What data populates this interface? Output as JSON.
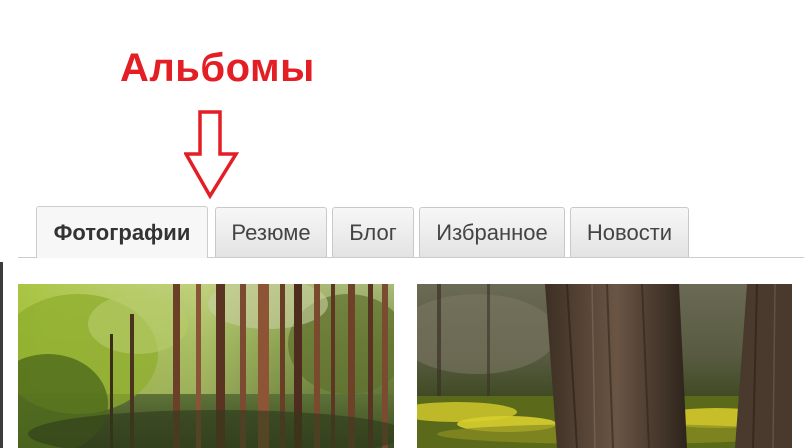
{
  "annotation": {
    "label": "Альбомы",
    "color": "#e31e24",
    "arrow_icon": "down-arrow-icon"
  },
  "tabs": [
    {
      "label": "Фотографии",
      "active": true
    },
    {
      "label": "Резюме",
      "active": false
    },
    {
      "label": "Блог",
      "active": false
    },
    {
      "label": "Избранное",
      "active": false
    },
    {
      "label": "Новости",
      "active": false
    }
  ],
  "photos": [
    {
      "subject": "pine-forest"
    },
    {
      "subject": "tree-trunks-yellow-flowers"
    }
  ]
}
